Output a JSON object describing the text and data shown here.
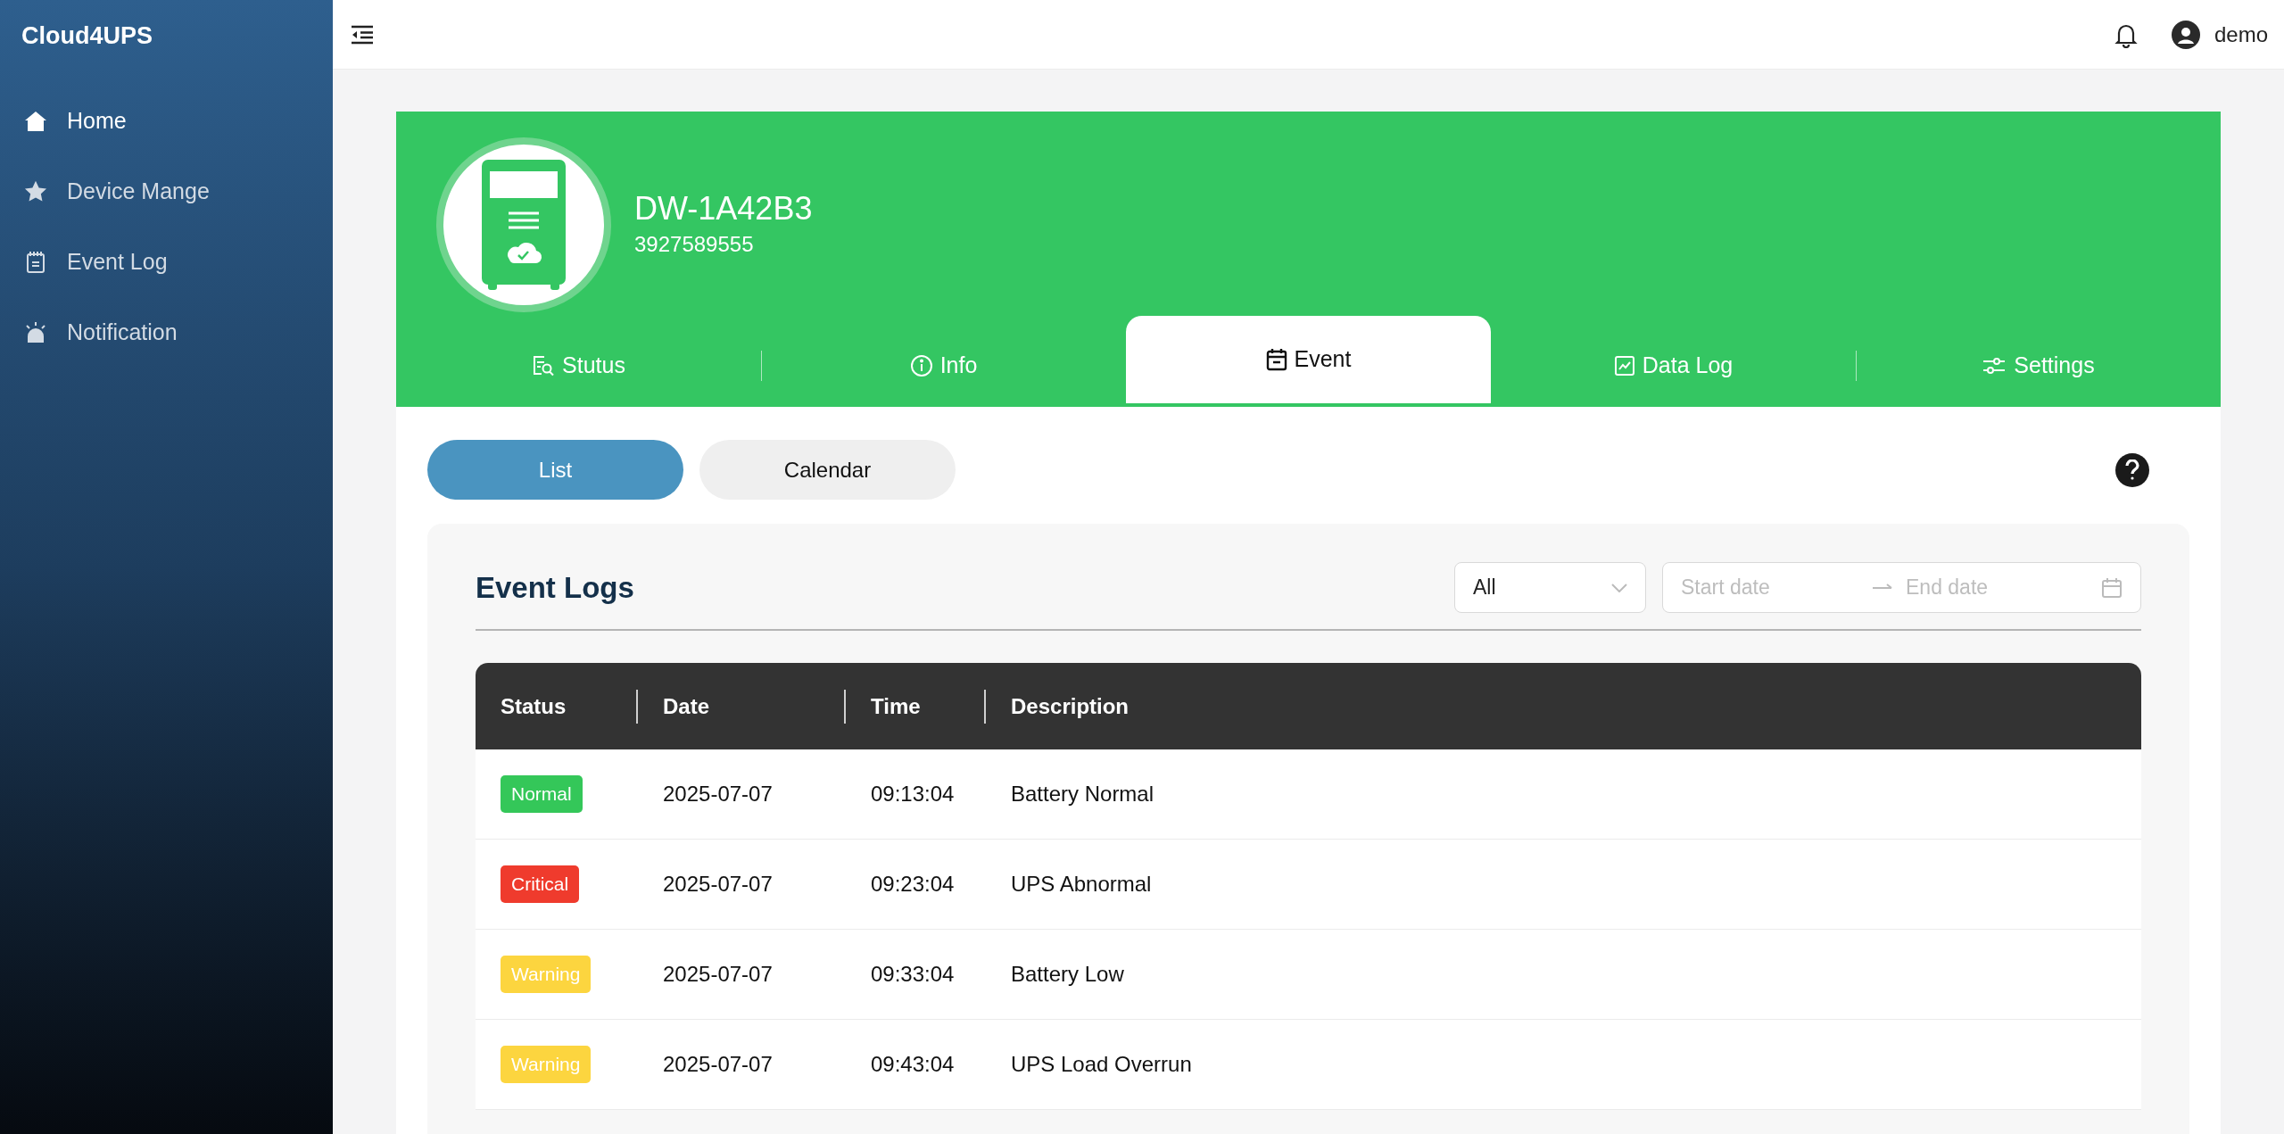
{
  "sidebar": {
    "brand": "Cloud4UPS",
    "items": [
      {
        "label": "Home",
        "selected": true
      },
      {
        "label": "Device Mange",
        "selected": false
      },
      {
        "label": "Event Log",
        "selected": false
      },
      {
        "label": "Notification",
        "selected": false
      }
    ]
  },
  "topbar": {
    "user": "demo"
  },
  "device": {
    "name": "DW-1A42B3",
    "serial": "3927589555"
  },
  "tabs": [
    {
      "label": "Stutus",
      "selected": false
    },
    {
      "label": "Info",
      "selected": false
    },
    {
      "label": "Event",
      "selected": true
    },
    {
      "label": "Data Log",
      "selected": false
    },
    {
      "label": "Settings",
      "selected": false
    }
  ],
  "view_toggle": [
    {
      "label": "List",
      "selected": true
    },
    {
      "label": "Calendar",
      "selected": false
    }
  ],
  "event_logs": {
    "title": "Event Logs",
    "filter": "All",
    "start_placeholder": "Start date",
    "end_placeholder": "End date",
    "columns": [
      "Status",
      "Date",
      "Time",
      "Description"
    ],
    "rows": [
      {
        "status": "Normal",
        "color": "#34c759",
        "date": "2025-07-07",
        "time": "09:13:04",
        "description": "Battery Normal"
      },
      {
        "status": "Critical",
        "color": "#ef3b2d",
        "date": "2025-07-07",
        "time": "09:23:04",
        "description": "UPS Abnormal"
      },
      {
        "status": "Warning",
        "color": "#fcd53f",
        "date": "2025-07-07",
        "time": "09:33:04",
        "description": "Battery Low"
      },
      {
        "status": "Warning",
        "color": "#fcd53f",
        "date": "2025-07-07",
        "time": "09:43:04",
        "description": "UPS Load Overrun"
      }
    ]
  }
}
